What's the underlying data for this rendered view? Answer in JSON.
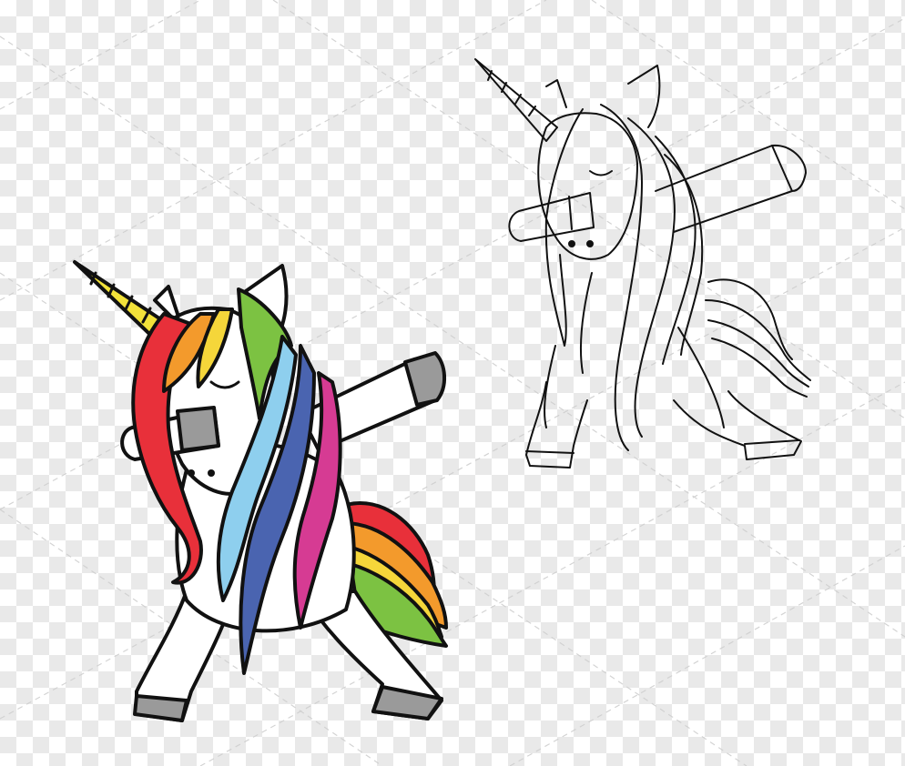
{
  "canvas": {
    "checker_light": "#ffffff",
    "checker_dark": "#e9e9e9"
  },
  "colored_unicorn": {
    "icon": "dabbing-unicorn-color-icon",
    "outline_color": "#111111",
    "body_color": "#ffffff",
    "hoof_color": "#9a9a9a",
    "horn_color": "#f2e23a",
    "mane_colors": [
      "#e8303a",
      "#f39a2c",
      "#f5d63a",
      "#7cc242",
      "#8ecfee",
      "#4a64b0",
      "#d63b93"
    ]
  },
  "outline_unicorn": {
    "icon": "dabbing-unicorn-outline-icon",
    "stroke_color": "#111111"
  },
  "watermark": {
    "icon": "diagonal-dashed-watermark-lines",
    "color": "#cfcfcf"
  }
}
